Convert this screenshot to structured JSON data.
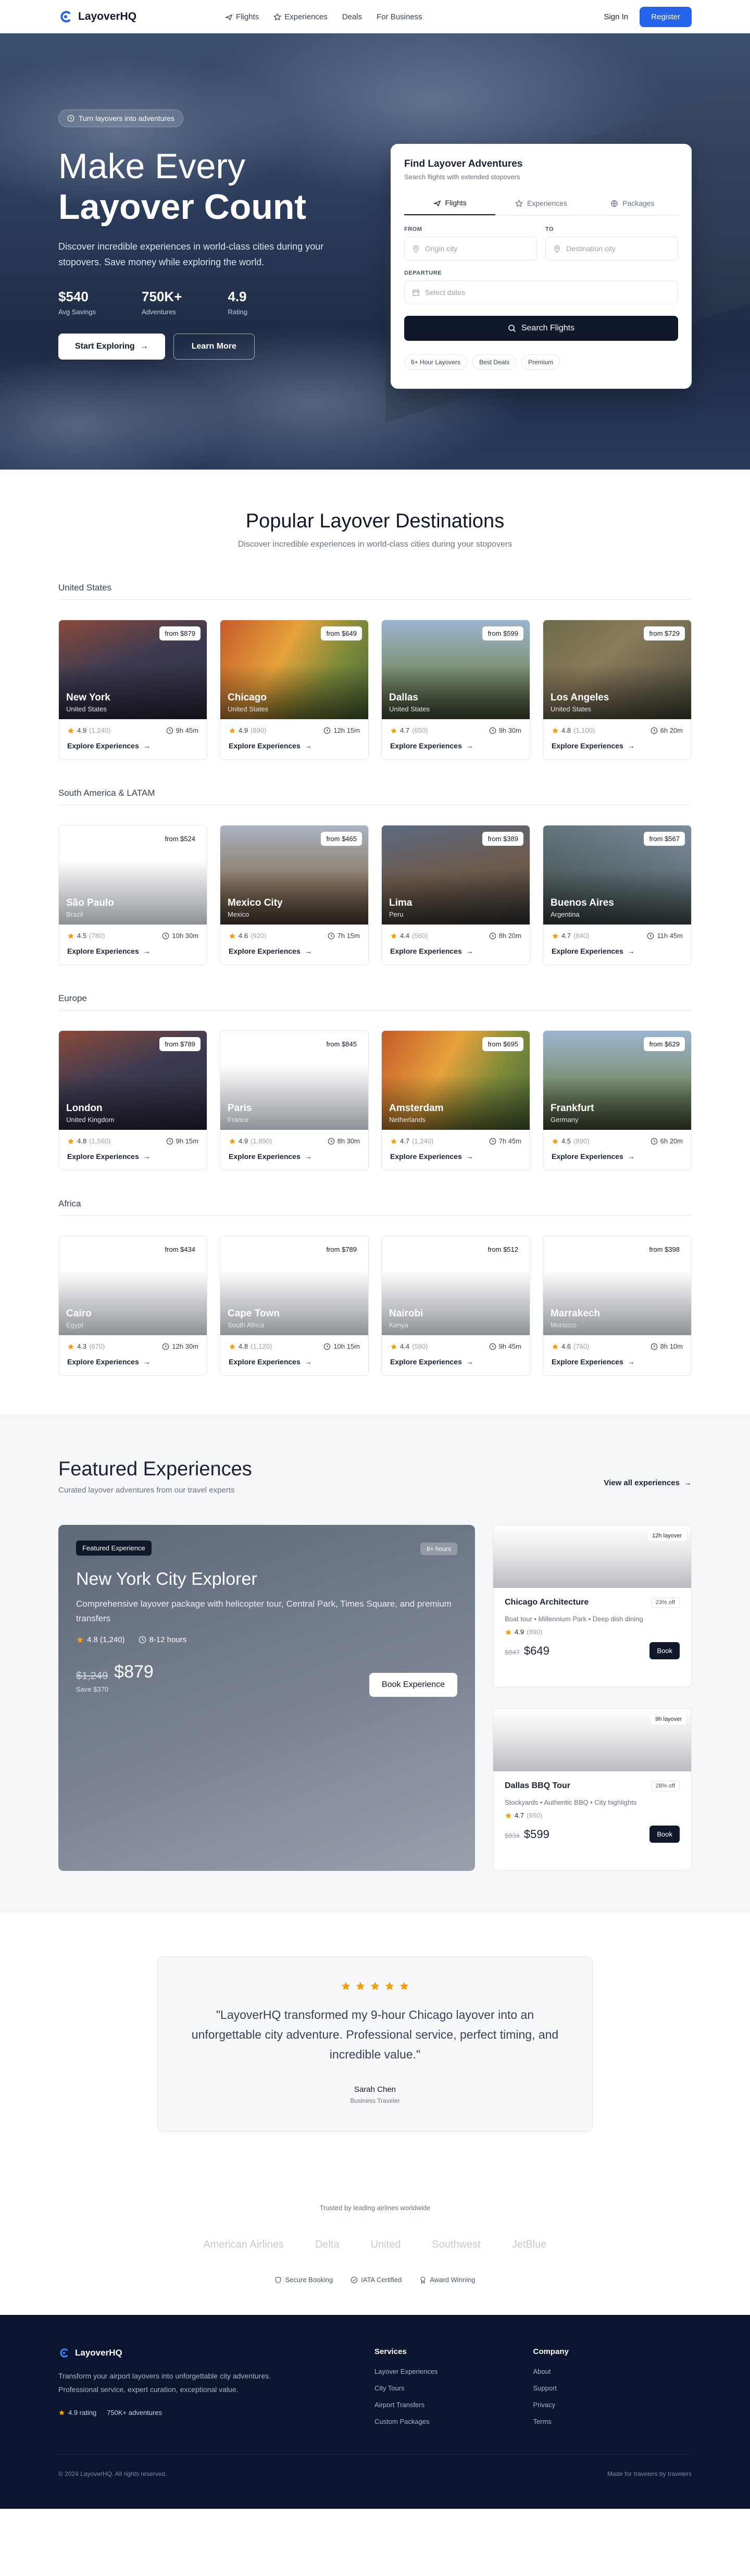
{
  "nav": {
    "brand": "LayoverHQ",
    "links": [
      {
        "label": "Flights",
        "icon": "plane-icon"
      },
      {
        "label": "Experiences",
        "icon": "star-icon"
      },
      {
        "label": "Deals"
      },
      {
        "label": "For Business"
      }
    ],
    "sign_in": "Sign In",
    "register": "Register",
    "accent": "#2563eb"
  },
  "hero": {
    "pill": "Turn layovers into adventures",
    "title_line1": "Make Every",
    "title_line2": "Layover Count",
    "subtitle": "Discover incredible experiences in world-class cities during your stopovers. Save money while exploring the world.",
    "stats": [
      {
        "value": "$540",
        "label": "Avg Savings"
      },
      {
        "value": "750K+",
        "label": "Adventures"
      },
      {
        "value": "4.9",
        "label": "Rating"
      }
    ],
    "primary_cta": "Start Exploring",
    "secondary_cta": "Learn More"
  },
  "search": {
    "title": "Find Layover Adventures",
    "subtitle": "Search flights with extended stopovers",
    "tabs": [
      "Flights",
      "Experiences",
      "Packages"
    ],
    "from_label": "FROM",
    "from_placeholder": "Origin city",
    "to_label": "TO",
    "to_placeholder": "Destination city",
    "departure_label": "DEPARTURE",
    "departure_placeholder": "Select dates",
    "button": "Search Flights",
    "chips": [
      "6+ Hour Layovers",
      "Best Deals",
      "Premium"
    ]
  },
  "destinations": {
    "title": "Popular Layover Destinations",
    "subtitle": "Discover incredible experiences in world-class cities during your stopovers",
    "explore_label": "Explore Experiences",
    "regions": [
      {
        "name": "United States",
        "cards": [
          {
            "city": "New York",
            "country": "United States",
            "price": "from $879",
            "rating": "4.9",
            "reviews": "(1,240)",
            "time": "9h 45m",
            "image": "photo"
          },
          {
            "city": "Chicago",
            "country": "United States",
            "price": "from $649",
            "rating": "4.9",
            "reviews": "(890)",
            "time": "12h 15m",
            "image": "photo"
          },
          {
            "city": "Dallas",
            "country": "United States",
            "price": "from $599",
            "rating": "4.7",
            "reviews": "(650)",
            "time": "9h 30m",
            "image": "photo"
          },
          {
            "city": "Los Angeles",
            "country": "United States",
            "price": "from $729",
            "rating": "4.8",
            "reviews": "(1,100)",
            "time": "6h 20m",
            "image": "photo"
          }
        ]
      },
      {
        "name": "South America & LATAM",
        "cards": [
          {
            "city": "São Paulo",
            "country": "Brazil",
            "price": "from $524",
            "rating": "4.5",
            "reviews": "(780)",
            "time": "10h 30m",
            "image": "blank"
          },
          {
            "city": "Mexico City",
            "country": "Mexico",
            "price": "from $465",
            "rating": "4.6",
            "reviews": "(920)",
            "time": "7h 15m",
            "image": "photo"
          },
          {
            "city": "Lima",
            "country": "Peru",
            "price": "from $389",
            "rating": "4.4",
            "reviews": "(560)",
            "time": "8h 20m",
            "image": "photo"
          },
          {
            "city": "Buenos Aires",
            "country": "Argentina",
            "price": "from $567",
            "rating": "4.7",
            "reviews": "(840)",
            "time": "11h 45m",
            "image": "photo"
          }
        ]
      },
      {
        "name": "Europe",
        "cards": [
          {
            "city": "London",
            "country": "United Kingdom",
            "price": "from $789",
            "rating": "4.8",
            "reviews": "(1,560)",
            "time": "9h 15m",
            "image": "photo"
          },
          {
            "city": "Paris",
            "country": "France",
            "price": "from $845",
            "rating": "4.9",
            "reviews": "(1,890)",
            "time": "8h 30m",
            "image": "blank"
          },
          {
            "city": "Amsterdam",
            "country": "Netherlands",
            "price": "from $695",
            "rating": "4.7",
            "reviews": "(1,240)",
            "time": "7h 45m",
            "image": "photo"
          },
          {
            "city": "Frankfurt",
            "country": "Germany",
            "price": "from $629",
            "rating": "4.5",
            "reviews": "(890)",
            "time": "6h 20m",
            "image": "photo"
          }
        ]
      },
      {
        "name": "Africa",
        "cards": [
          {
            "city": "Cairo",
            "country": "Egypt",
            "price": "from $434",
            "rating": "4.3",
            "reviews": "(670)",
            "time": "12h 30m",
            "image": "blank"
          },
          {
            "city": "Cape Town",
            "country": "South Africa",
            "price": "from $789",
            "rating": "4.8",
            "reviews": "(1,120)",
            "time": "10h 15m",
            "image": "blank"
          },
          {
            "city": "Nairobi",
            "country": "Kenya",
            "price": "from $512",
            "rating": "4.4",
            "reviews": "(580)",
            "time": "9h 45m",
            "image": "blank"
          },
          {
            "city": "Marrakech",
            "country": "Morocco",
            "price": "from $398",
            "rating": "4.6",
            "reviews": "(760)",
            "time": "8h 10m",
            "image": "blank"
          }
        ]
      }
    ]
  },
  "featured": {
    "title": "Featured Experiences",
    "subtitle": "Curated layover adventures from our travel experts",
    "view_all": "View all experiences",
    "main": {
      "badge": "Featured Experience",
      "hours": "8+ hours",
      "title": "New York City Explorer",
      "desc": "Comprehensive layover package with helicopter tour, Central Park, Times Square, and premium transfers",
      "rating": "4.8 (1,240)",
      "duration": "8-12 hours",
      "old_price": "$1,249",
      "new_price": "$879",
      "save": "Save $370",
      "button": "Book Experience"
    },
    "side": [
      {
        "layover": "12h layover",
        "title": "Chicago Architecture",
        "off": "23% off",
        "tags": "Boat tour • Millennium Park • Deep dish dining",
        "rating": "4.9",
        "reviews": "(890)",
        "old": "$847",
        "new": "$649",
        "button": "Book"
      },
      {
        "layover": "9h layover",
        "title": "Dallas BBQ Tour",
        "off": "28% off",
        "tags": "Stockyards • Authentic BBQ • City highlights",
        "rating": "4.7",
        "reviews": "(650)",
        "old": "$834",
        "new": "$599",
        "button": "Book"
      }
    ]
  },
  "testimonial": {
    "quote": "\"LayoverHQ transformed my 9-hour Chicago layover into an unforgettable city adventure. Professional service, perfect timing, and incredible value.\"",
    "author": "Sarah Chen",
    "role": "Business Traveler",
    "star_color": "#f59e0b"
  },
  "trusted": {
    "title": "Trusted by leading airlines worldwide",
    "airlines": [
      "American Airlines",
      "Delta",
      "United",
      "Southwest",
      "JetBlue"
    ],
    "badges": [
      {
        "label": "Secure Booking",
        "icon": "shield-icon"
      },
      {
        "label": "IATA Certified",
        "icon": "check-circle-icon"
      },
      {
        "label": "Award Winning",
        "icon": "award-icon"
      }
    ]
  },
  "footer": {
    "brand": "LayoverHQ",
    "desc": "Transform your airport layovers into unforgettable city adventures. Professional service, expert curation, exceptional value.",
    "rating": "4.9 rating",
    "travelers": "750K+ adventures",
    "services_title": "Services",
    "services": [
      "Layover Experiences",
      "City Tours",
      "Airport Transfers",
      "Custom Packages"
    ],
    "company_title": "Company",
    "company": [
      "About",
      "Support",
      "Privacy",
      "Terms"
    ],
    "copyright": "© 2024 LayoverHQ. All rights reserved.",
    "made_by": "Made for travelers by travelers"
  }
}
